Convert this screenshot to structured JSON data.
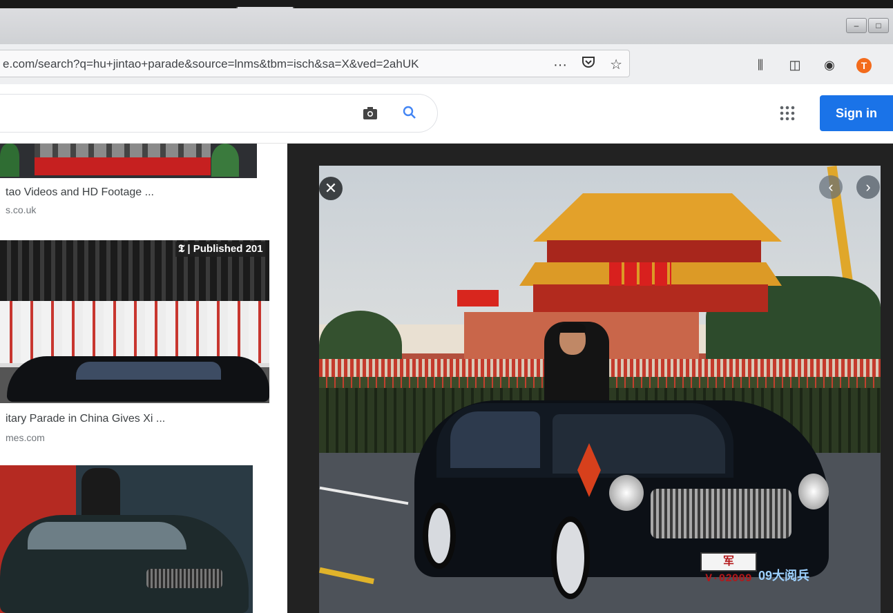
{
  "browser": {
    "url": "e.com/search?q=hu+jintao+parade&source=lnms&tbm=isch&sa=X&ved=2ahUK",
    "url_actions": {
      "more": "···",
      "pocket_icon": "pocket-icon",
      "bookmark_icon": "star-icon"
    },
    "toolbar_icons": [
      "library-icon",
      "sidebar-icon",
      "account-icon",
      "extension-t-icon",
      "extension-leaf-icon"
    ],
    "extension_t_label": "T"
  },
  "google": {
    "search_value": "",
    "sign_in_label": "Sign in",
    "accent": "#1a73e8"
  },
  "results": [
    {
      "title": "tao Videos and HD Footage ...",
      "source": "s.co.uk"
    },
    {
      "title": "itary Parade in China Gives Xi ...",
      "source": "mes.com",
      "badge": "Published 201"
    },
    {
      "title": "",
      "source": ""
    }
  ],
  "viewer": {
    "plate": "V·02009",
    "plate_prefix": "军",
    "broadcast_logo": "09大阅兵"
  }
}
